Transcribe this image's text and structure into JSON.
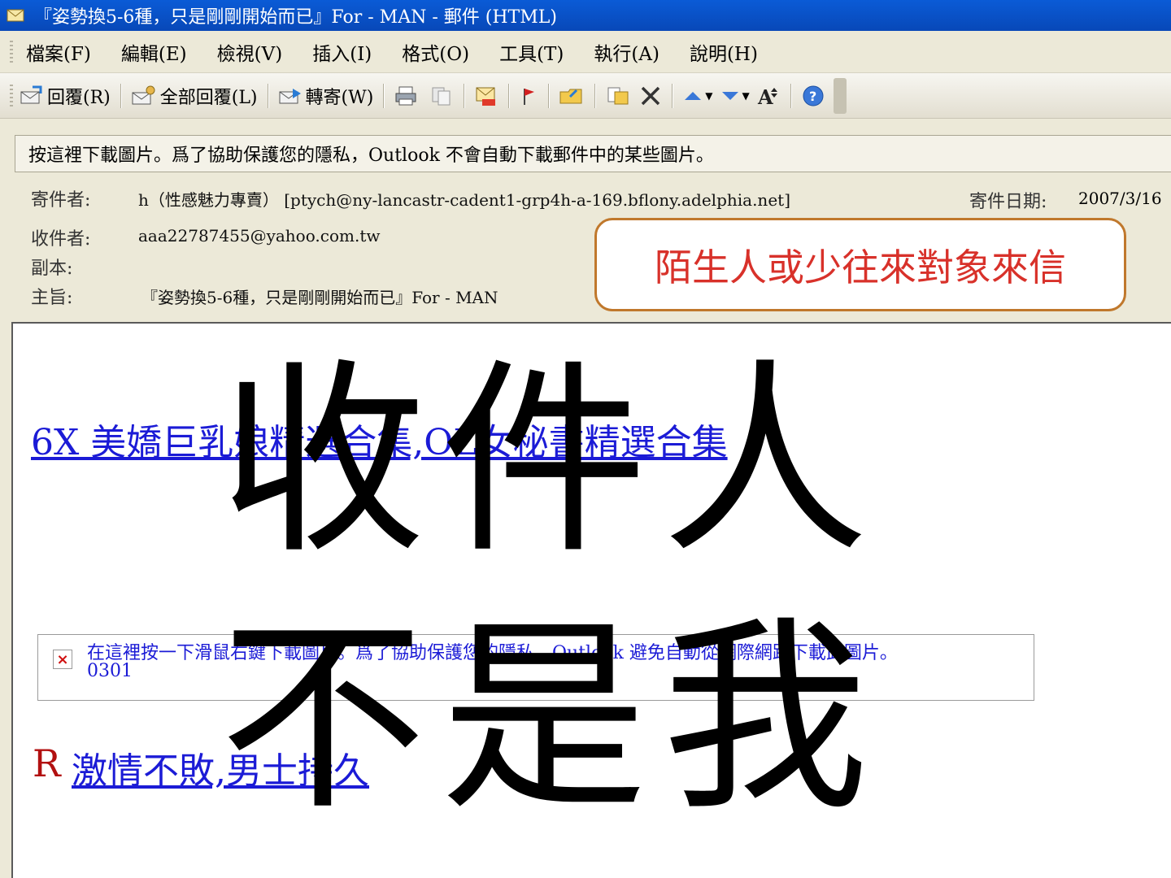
{
  "window": {
    "title": "『姿勢換5-6種，只是剛剛開始而已』For - MAN - 郵件 (HTML)"
  },
  "menu": {
    "items": [
      "檔案(F)",
      "編輯(E)",
      "檢視(V)",
      "插入(I)",
      "格式(O)",
      "工具(T)",
      "執行(A)",
      "說明(H)"
    ]
  },
  "toolbar": {
    "reply_label": "回覆(R)",
    "reply_all_label": "全部回覆(L)",
    "forward_label": "轉寄(W)",
    "icons": [
      "reply-icon",
      "reply-all-icon",
      "forward-icon",
      "print-icon",
      "copy-icon",
      "envelope-icon",
      "flag-icon",
      "folder-icon",
      "move-icon",
      "delete-icon",
      "prev-icon",
      "next-icon",
      "font-size-icon",
      "help-icon"
    ]
  },
  "infobar": {
    "text": "按這裡下載圖片。爲了協助保護您的隱私，Outlook 不會自動下載郵件中的某些圖片。"
  },
  "header": {
    "from_label": "寄件者:",
    "from_value": "h（性感魅力專賣） [ptych@ny-lancastr-cadent1-grp4h-a-169.bflony.adelphia.net]",
    "date_label": "寄件日期:",
    "date_value": "2007/3/16",
    "to_label": "收件者:",
    "to_value": "aaa22787455@yahoo.com.tw",
    "cc_label": "副本:",
    "subject_label": "主旨:",
    "subject_value": "『姿勢換5-6種，只是剛剛開始而已』For - MAN"
  },
  "callout": {
    "text": "陌生人或少往來對象來信"
  },
  "body": {
    "link1": "6X 美嬌巨乳娘精選合集,OL女秘書精選合集",
    "image_blocked_text": "在這裡按一下滑鼠右鍵下載圖片。爲了協助保護您的隱私，Outlook 避免自動從網際網路下載此圖片。",
    "image_blocked_code": "0301",
    "r_letter": "R",
    "link2": "激情不敗,男士持久"
  },
  "overlay": {
    "line1": "收件人",
    "line2": "不是我"
  },
  "colors": {
    "titlebar": "#0848b8",
    "link": "#1b1bd6",
    "callout_text": "#d8312a",
    "callout_border": "#c0782c",
    "r_letter": "#b21010"
  }
}
